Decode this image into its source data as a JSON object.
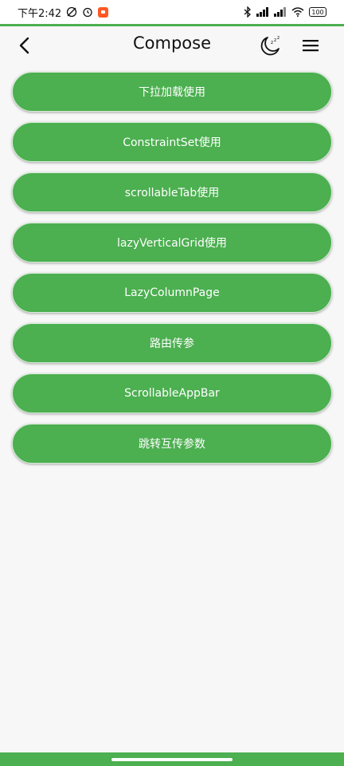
{
  "status_bar": {
    "time": "下午2:42",
    "battery": "100"
  },
  "app_bar": {
    "title": "Compose",
    "back_icon": "back-arrow-icon",
    "night_icon": "moon-sleep-icon",
    "menu_icon": "hamburger-menu-icon"
  },
  "items": [
    {
      "label": "下拉加载使用"
    },
    {
      "label": "ConstraintSet使用"
    },
    {
      "label": "scrollableTab使用"
    },
    {
      "label": "lazyVerticalGrid使用"
    },
    {
      "label": "LazyColumnPage"
    },
    {
      "label": "路由传参"
    },
    {
      "label": "ScrollableAppBar"
    },
    {
      "label": "跳转互传参数"
    }
  ],
  "colors": {
    "primary": "#4caf50",
    "background": "#f7f7f7",
    "button_text": "#ffffff"
  }
}
